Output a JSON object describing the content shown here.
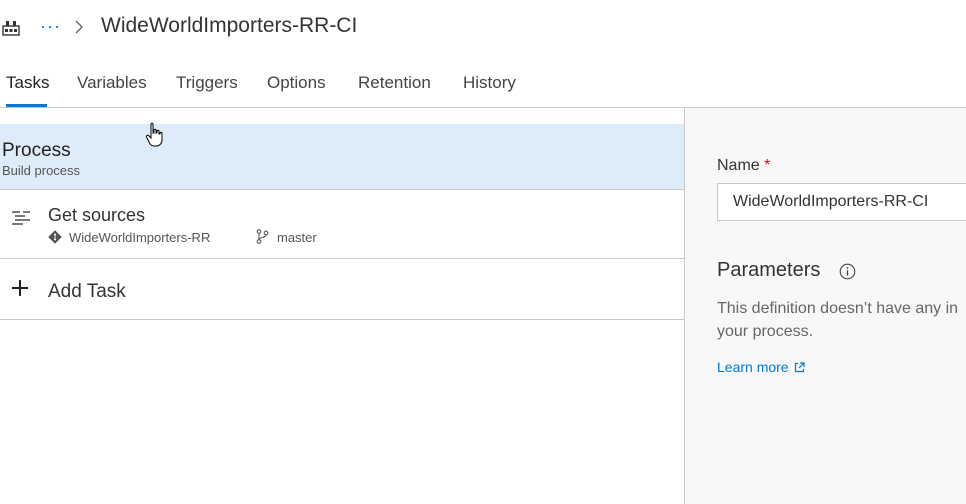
{
  "header": {
    "title": "WideWorldImporters-RR-CI",
    "more_label": "···",
    "icons": {
      "pipeline": "pipeline-icon",
      "more": "more-icon",
      "breadcrumb_separator": "chevron-right-icon"
    }
  },
  "tabs": [
    {
      "label": "Tasks",
      "active": true
    },
    {
      "label": "Variables"
    },
    {
      "label": "Triggers"
    },
    {
      "label": "Options"
    },
    {
      "label": "Retention"
    },
    {
      "label": "History"
    }
  ],
  "process": {
    "title": "Process",
    "subtitle": "Build process"
  },
  "get_sources": {
    "title": "Get sources",
    "repository": "WideWorldImporters-RR",
    "branch": "master",
    "icons": {
      "task": "list-icon",
      "repo": "git-repo-icon",
      "branch": "branch-icon"
    }
  },
  "add_task": {
    "label": "Add Task",
    "icon": "plus-icon"
  },
  "details": {
    "name_label": "Name",
    "required_mark": "*",
    "name_value": "WideWorldImporters-RR-CI",
    "parameters_title": "Parameters",
    "parameters_text": "This definition doesn’t have any in your process.",
    "learn_more": "Learn more",
    "icons": {
      "info": "info-icon",
      "external": "external-link-icon"
    }
  },
  "colors": {
    "accent": "#0078d4",
    "selected_row": "#deecf9",
    "required": "#c50f1f",
    "panel_bg": "#f8f8f8",
    "divider": "#c8c8c8"
  }
}
